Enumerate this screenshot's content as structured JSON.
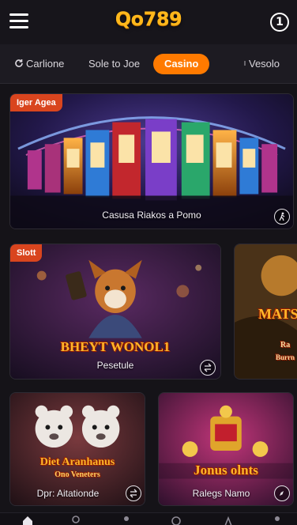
{
  "header": {
    "logo": "Qo789",
    "account_label": "1"
  },
  "tabs": [
    {
      "label": "Carlione",
      "icon": "refresh-icon"
    },
    {
      "label": "Sole to Joe"
    },
    {
      "label": "Casino",
      "active": true
    },
    {
      "label": "Vesolo",
      "icon": "bolt-icon"
    }
  ],
  "cards": {
    "hero": {
      "badge": "Iger Agea",
      "caption": "Casusa Riakos a Pomo",
      "action_icon": "figure-icon"
    },
    "slot": {
      "badge": "Slott",
      "title": "BHEYT WONOL1",
      "caption": "Pesetule",
      "action_icon": "swap-icon"
    },
    "side": {
      "title_1": "MATS",
      "title_2": "Ra",
      "title_3": "Burrn"
    },
    "bear": {
      "title": "Diet Aranhanus",
      "subtitle": "Ono Veneters",
      "caption": "Dpr: Aitationde",
      "action_icon": "swap-icon"
    },
    "jonus": {
      "title": "Jonus olnts",
      "caption": "Ralegs Namo",
      "action_icon": "compass-icon"
    }
  },
  "colors": {
    "accent": "#ff7a00",
    "logo": "#ffb81c",
    "badge": "#d9451e",
    "background": "#151318"
  },
  "bottom_nav": [
    "home-icon",
    "search-icon",
    "user-icon",
    "clock-icon",
    "profile-icon"
  ]
}
